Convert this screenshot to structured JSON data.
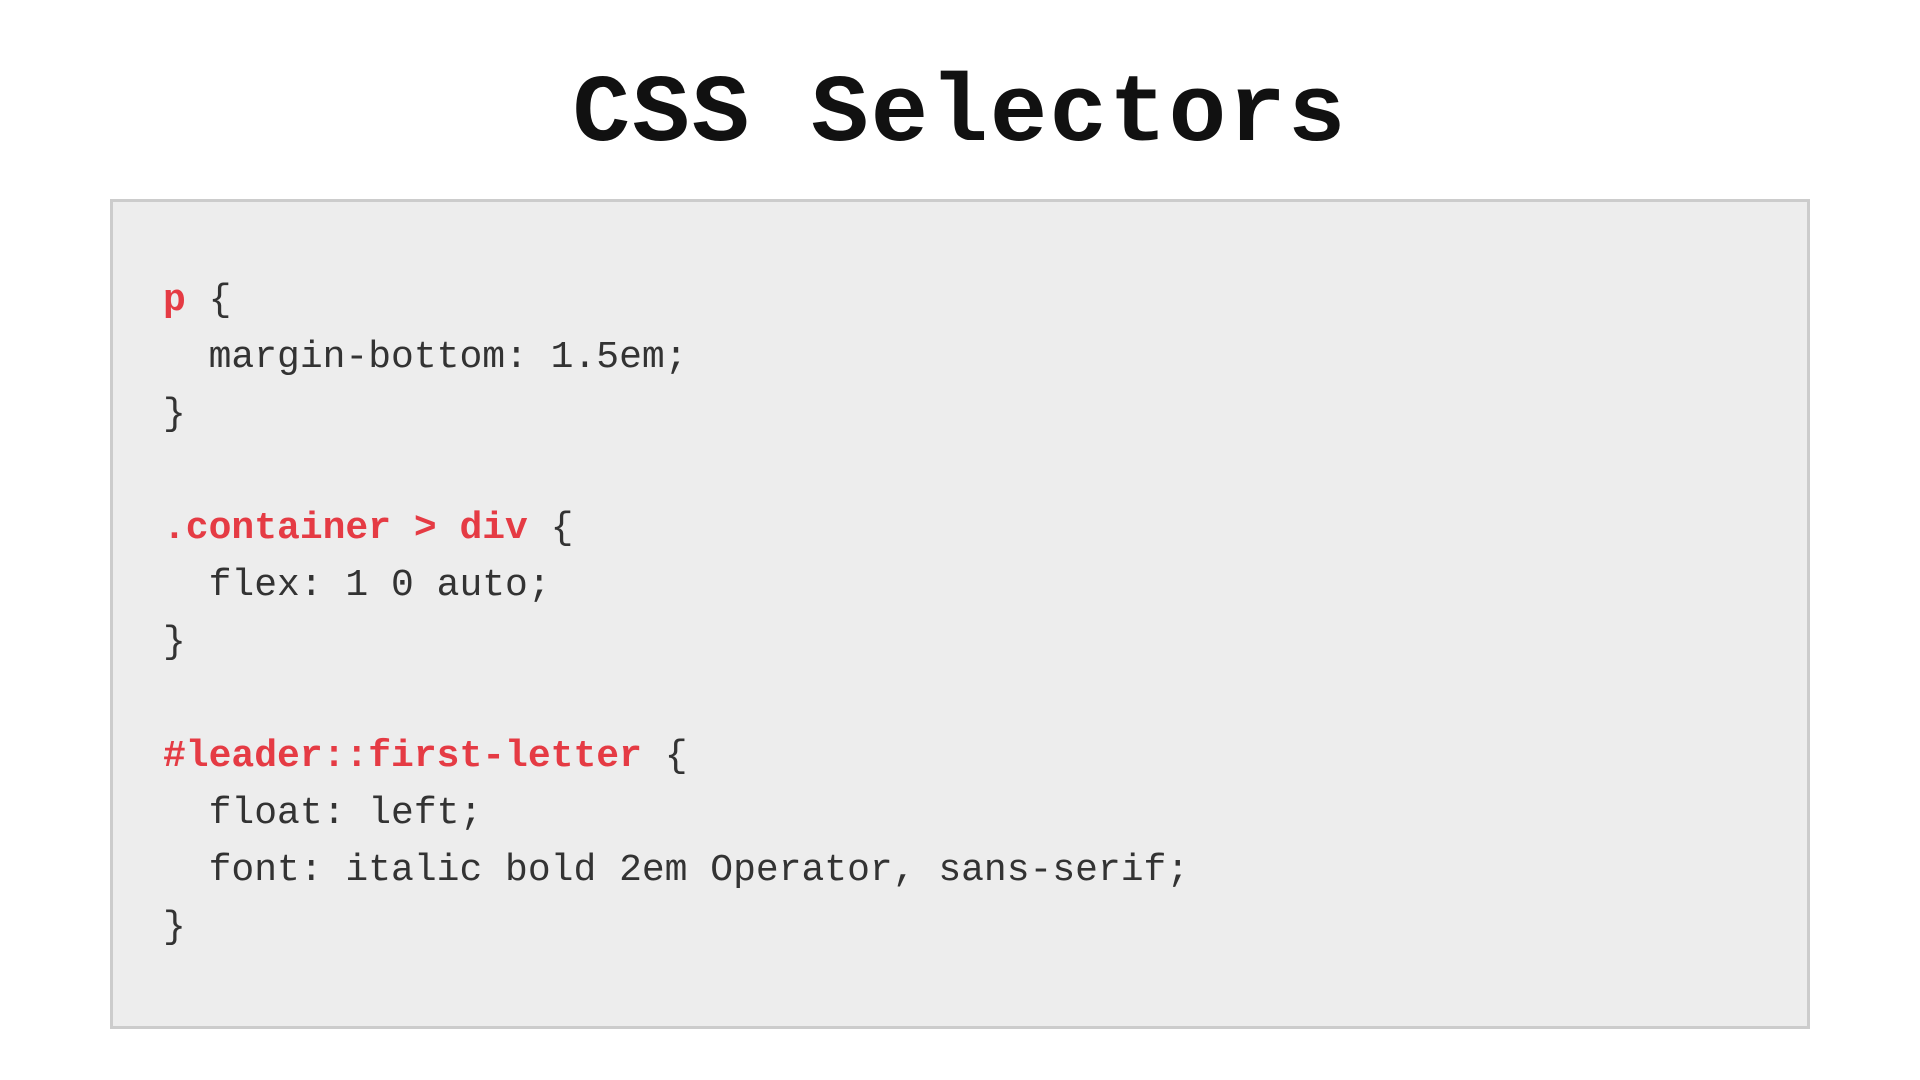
{
  "title": "CSS Selectors",
  "code": {
    "rules": [
      {
        "selector": "p",
        "open": " {",
        "decl1": "  margin-bottom: 1.5em;",
        "close": "}"
      },
      {
        "selector": ".container > div",
        "open": " {",
        "decl1": "  flex: 1 0 auto;",
        "close": "}"
      },
      {
        "selector": "#leader::first-letter",
        "open": " {",
        "decl1": "  float: left;",
        "decl2": "  font: italic bold 2em Operator, sans-serif;",
        "close": "}"
      }
    ]
  },
  "colors": {
    "selector": "#e53b44",
    "text": "#333333",
    "box_bg": "#ededed",
    "box_border": "#cccccc"
  }
}
